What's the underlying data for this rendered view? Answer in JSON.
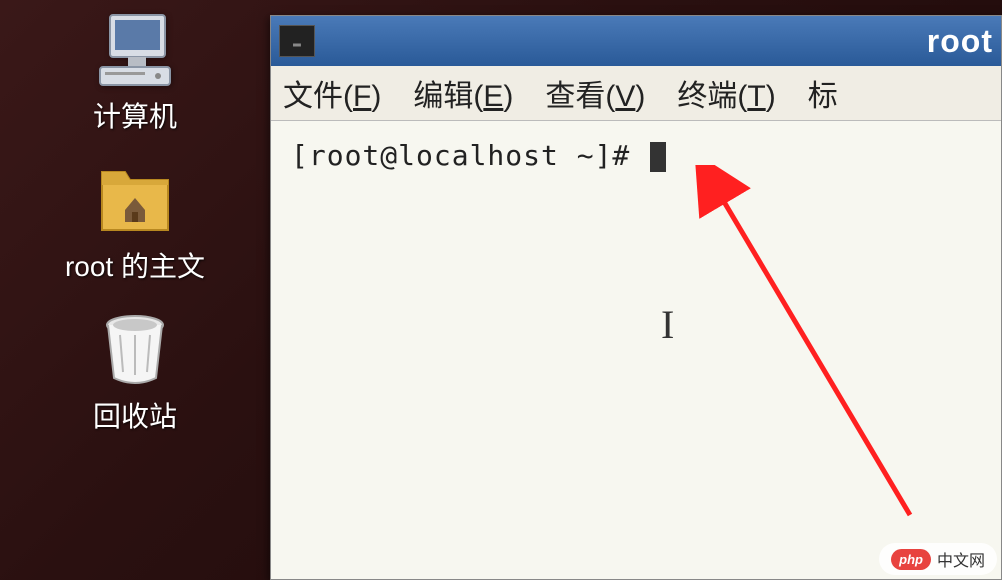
{
  "desktop": {
    "icons": [
      {
        "name": "computer",
        "label": "计算机"
      },
      {
        "name": "home-folder",
        "label": "root 的主文"
      },
      {
        "name": "trash",
        "label": "回收站"
      }
    ]
  },
  "terminal": {
    "title": "root",
    "menus": [
      {
        "label": "文件(F)",
        "key": "F"
      },
      {
        "label": "编辑(E)",
        "key": "E"
      },
      {
        "label": "查看(V)",
        "key": "V"
      },
      {
        "label": "终端(T)",
        "key": "T"
      },
      {
        "label": "标",
        "key": ""
      }
    ],
    "prompt": "[root@localhost ~]#"
  },
  "watermark": {
    "logo": "php",
    "text": "中文网"
  }
}
